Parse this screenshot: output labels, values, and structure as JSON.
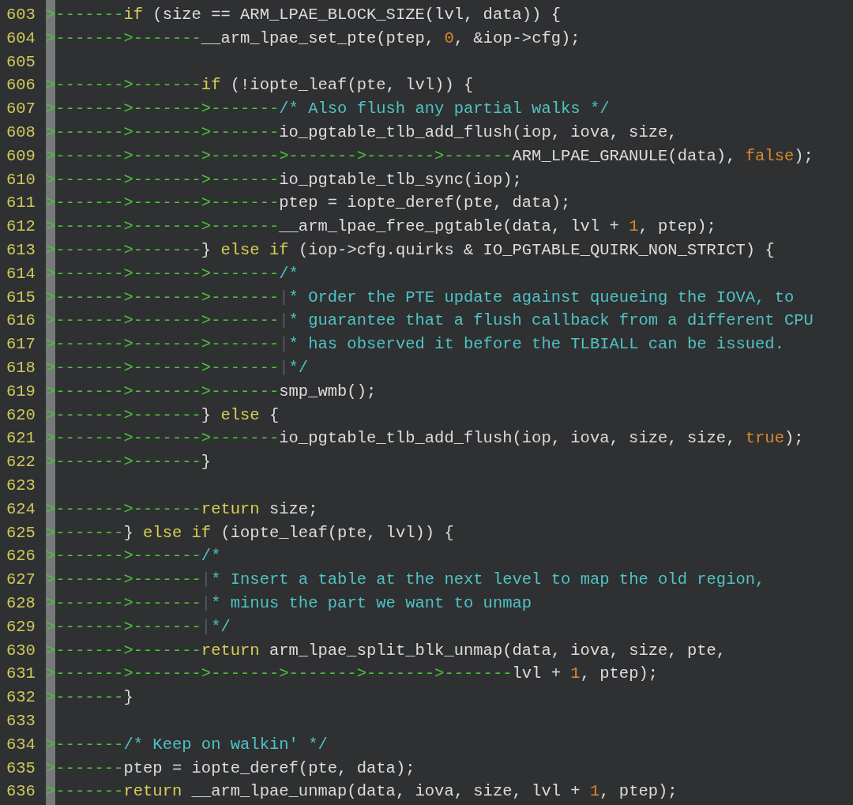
{
  "editor": {
    "lines": [
      {
        "number": "603",
        "segments": [
          {
            "kind": "tab",
            "text": ">-------"
          },
          {
            "kind": "keyword",
            "text": "if"
          },
          {
            "kind": "plain",
            "text": " (size == ARM_LPAE_BLOCK_SIZE(lvl, data)) {"
          }
        ]
      },
      {
        "number": "604",
        "segments": [
          {
            "kind": "tab",
            "text": ">------->-------"
          },
          {
            "kind": "plain",
            "text": "__arm_lpae_set_pte(ptep, "
          },
          {
            "kind": "constant",
            "text": "0"
          },
          {
            "kind": "plain",
            "text": ", &iop->cfg);"
          }
        ]
      },
      {
        "number": "605"
      },
      {
        "number": "606",
        "segments": [
          {
            "kind": "tab",
            "text": ">------->-------"
          },
          {
            "kind": "keyword",
            "text": "if"
          },
          {
            "kind": "plain",
            "text": " (!iopte_leaf(pte, lvl)) {"
          }
        ]
      },
      {
        "number": "607",
        "segments": [
          {
            "kind": "tab",
            "text": ">------->------->-------"
          },
          {
            "kind": "comment",
            "text": "/* Also flush any partial walks */"
          }
        ]
      },
      {
        "number": "608",
        "segments": [
          {
            "kind": "tab",
            "text": ">------->------->-------"
          },
          {
            "kind": "plain",
            "text": "io_pgtable_tlb_add_flush(iop, iova, size,"
          }
        ]
      },
      {
        "number": "609",
        "segments": [
          {
            "kind": "tab",
            "text": ">------->------->------->------->------->-------"
          },
          {
            "kind": "plain",
            "text": "ARM_LPAE_GRANULE(data), "
          },
          {
            "kind": "constant",
            "text": "false"
          },
          {
            "kind": "plain",
            "text": ");"
          }
        ]
      },
      {
        "number": "610",
        "segments": [
          {
            "kind": "tab",
            "text": ">------->------->-------"
          },
          {
            "kind": "plain",
            "text": "io_pgtable_tlb_sync(iop);"
          }
        ]
      },
      {
        "number": "611",
        "segments": [
          {
            "kind": "tab",
            "text": ">------->------->-------"
          },
          {
            "kind": "plain",
            "text": "ptep = iopte_deref(pte, data);"
          }
        ]
      },
      {
        "number": "612",
        "segments": [
          {
            "kind": "tab",
            "text": ">------->------->-------"
          },
          {
            "kind": "plain",
            "text": "__arm_lpae_free_pgtable(data, lvl + "
          },
          {
            "kind": "constant",
            "text": "1"
          },
          {
            "kind": "plain",
            "text": ", ptep);"
          }
        ]
      },
      {
        "number": "613",
        "segments": [
          {
            "kind": "tab",
            "text": ">------->-------"
          },
          {
            "kind": "plain",
            "text": "} "
          },
          {
            "kind": "keyword",
            "text": "else if"
          },
          {
            "kind": "plain",
            "text": " (iop->cfg.quirks & IO_PGTABLE_QUIRK_NON_STRICT) {"
          }
        ]
      },
      {
        "number": "614",
        "segments": [
          {
            "kind": "tab",
            "text": ">------->------->-------"
          },
          {
            "kind": "comment",
            "text": "/*"
          }
        ]
      },
      {
        "number": "615",
        "segments": [
          {
            "kind": "tab",
            "text": ">------->------->-------"
          },
          {
            "kind": "guide",
            "text": "|"
          },
          {
            "kind": "comment",
            "text": "* Order the PTE update against queueing the IOVA, to"
          }
        ]
      },
      {
        "number": "616",
        "segments": [
          {
            "kind": "tab",
            "text": ">------->------->-------"
          },
          {
            "kind": "guide",
            "text": "|"
          },
          {
            "kind": "comment",
            "text": "* guarantee that a flush callback from a different CPU"
          }
        ]
      },
      {
        "number": "617",
        "segments": [
          {
            "kind": "tab",
            "text": ">------->------->-------"
          },
          {
            "kind": "guide",
            "text": "|"
          },
          {
            "kind": "comment",
            "text": "* has observed it before the TLBIALL can be issued."
          }
        ]
      },
      {
        "number": "618",
        "segments": [
          {
            "kind": "tab",
            "text": ">------->------->-------"
          },
          {
            "kind": "guide",
            "text": "|"
          },
          {
            "kind": "comment",
            "text": "*/"
          }
        ]
      },
      {
        "number": "619",
        "segments": [
          {
            "kind": "tab",
            "text": ">------->------->-------"
          },
          {
            "kind": "plain",
            "text": "smp_wmb();"
          }
        ]
      },
      {
        "number": "620",
        "segments": [
          {
            "kind": "tab",
            "text": ">------->-------"
          },
          {
            "kind": "plain",
            "text": "} "
          },
          {
            "kind": "keyword",
            "text": "else"
          },
          {
            "kind": "plain",
            "text": " {"
          }
        ]
      },
      {
        "number": "621",
        "segments": [
          {
            "kind": "tab",
            "text": ">------->------->-------"
          },
          {
            "kind": "plain",
            "text": "io_pgtable_tlb_add_flush(iop, iova, size, size, "
          },
          {
            "kind": "constant",
            "text": "true"
          },
          {
            "kind": "plain",
            "text": ");"
          }
        ]
      },
      {
        "number": "622",
        "segments": [
          {
            "kind": "tab",
            "text": ">------->-------"
          },
          {
            "kind": "plain",
            "text": "}"
          }
        ]
      },
      {
        "number": "623"
      },
      {
        "number": "624",
        "segments": [
          {
            "kind": "tab",
            "text": ">------->-------"
          },
          {
            "kind": "keyword",
            "text": "return"
          },
          {
            "kind": "plain",
            "text": " size;"
          }
        ]
      },
      {
        "number": "625",
        "segments": [
          {
            "kind": "tab",
            "text": ">-------"
          },
          {
            "kind": "plain",
            "text": "} "
          },
          {
            "kind": "keyword",
            "text": "else if"
          },
          {
            "kind": "plain",
            "text": " (iopte_leaf(pte, lvl)) {"
          }
        ]
      },
      {
        "number": "626",
        "segments": [
          {
            "kind": "tab",
            "text": ">------->-------"
          },
          {
            "kind": "comment",
            "text": "/*"
          }
        ]
      },
      {
        "number": "627",
        "segments": [
          {
            "kind": "tab",
            "text": ">------->-------"
          },
          {
            "kind": "guide",
            "text": "|"
          },
          {
            "kind": "comment",
            "text": "* Insert a table at the next level to map the old region,"
          }
        ]
      },
      {
        "number": "628",
        "segments": [
          {
            "kind": "tab",
            "text": ">------->-------"
          },
          {
            "kind": "guide",
            "text": "|"
          },
          {
            "kind": "comment",
            "text": "* minus the part we want to unmap"
          }
        ]
      },
      {
        "number": "629",
        "segments": [
          {
            "kind": "tab",
            "text": ">------->-------"
          },
          {
            "kind": "guide",
            "text": "|"
          },
          {
            "kind": "comment",
            "text": "*/"
          }
        ]
      },
      {
        "number": "630",
        "segments": [
          {
            "kind": "tab",
            "text": ">------->-------"
          },
          {
            "kind": "keyword",
            "text": "return"
          },
          {
            "kind": "plain",
            "text": " arm_lpae_split_blk_unmap(data, iova, size, pte,"
          }
        ]
      },
      {
        "number": "631",
        "segments": [
          {
            "kind": "tab",
            "text": ">------->------->------->------->------->-------"
          },
          {
            "kind": "plain",
            "text": "lvl + "
          },
          {
            "kind": "constant",
            "text": "1"
          },
          {
            "kind": "plain",
            "text": ", ptep);"
          }
        ]
      },
      {
        "number": "632",
        "segments": [
          {
            "kind": "tab",
            "text": ">-------"
          },
          {
            "kind": "plain",
            "text": "}"
          }
        ]
      },
      {
        "number": "633"
      },
      {
        "number": "634",
        "segments": [
          {
            "kind": "tab",
            "text": ">-------"
          },
          {
            "kind": "comment",
            "text": "/* Keep on walkin' */"
          }
        ]
      },
      {
        "number": "635",
        "segments": [
          {
            "kind": "tab",
            "text": ">-------"
          },
          {
            "kind": "plain",
            "text": "ptep = iopte_deref(pte, data);"
          }
        ]
      },
      {
        "number": "636",
        "segments": [
          {
            "kind": "tab",
            "text": ">-------"
          },
          {
            "kind": "keyword",
            "text": "return"
          },
          {
            "kind": "plain",
            "text": " __arm_lpae_unmap(data, iova, size, lvl + "
          },
          {
            "kind": "constant",
            "text": "1"
          },
          {
            "kind": "plain",
            "text": ", ptep);"
          }
        ]
      }
    ]
  }
}
